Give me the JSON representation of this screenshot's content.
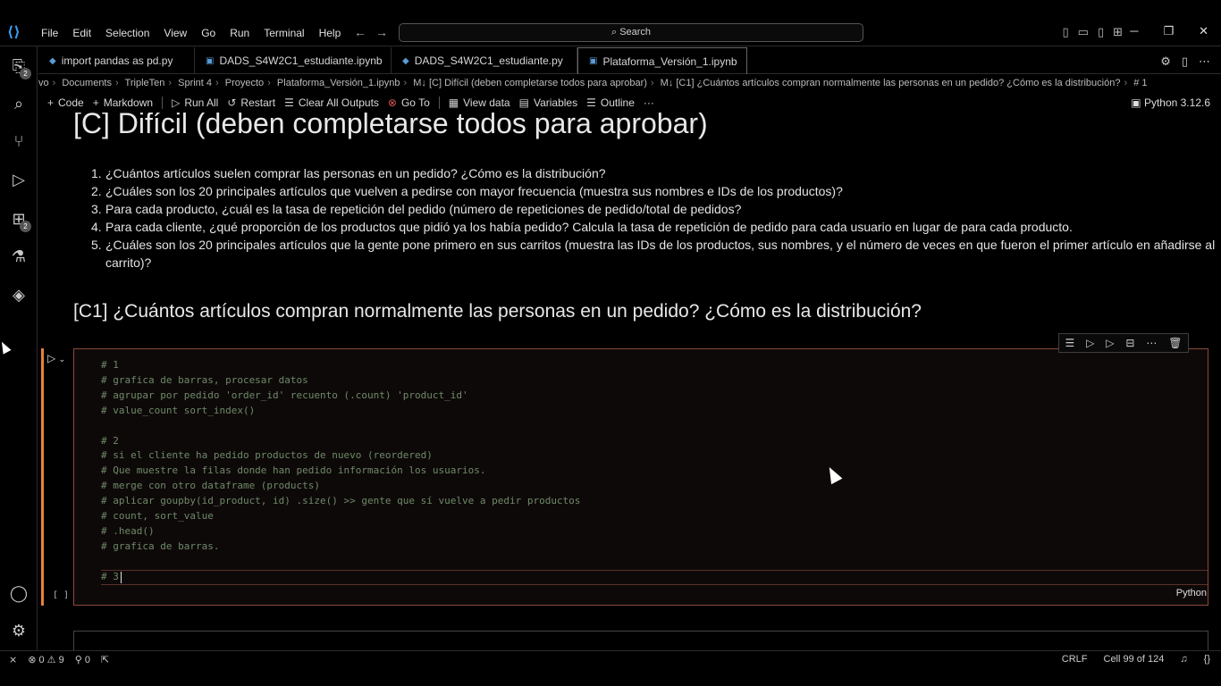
{
  "menu": [
    "File",
    "Edit",
    "Selection",
    "View",
    "Go",
    "Run",
    "Terminal",
    "Help"
  ],
  "search": {
    "label": "Search"
  },
  "tabs": [
    {
      "label": "import pandas as pd.py",
      "dirty": false
    },
    {
      "label": "DADS_S4W2C1_estudiante.ipynb",
      "dirty": true
    },
    {
      "label": "DADS_S4W2C1_estudiante.py",
      "dirty": false
    },
    {
      "label": "Plataforma_Versión_1.ipynb",
      "dirty": true
    }
  ],
  "breadcrumb": [
    "vo",
    "Documents",
    "TripleTen",
    "Sprint 4",
    "Proyecto",
    "Plataforma_Versión_1.ipynb",
    "M↓ [C] Difícil (deben completarse todos para aprobar)",
    "M↓ [C1] ¿Cuántos artículos compran normalmente las personas en un pedido? ¿Cómo es la distribución?",
    "# 1"
  ],
  "toolbar": {
    "code": "Code",
    "markdown": "Markdown",
    "run_all": "Run All",
    "restart": "Restart",
    "clear_outputs": "Clear All Outputs",
    "go_to": "Go To",
    "view_data": "View data",
    "variables": "Variables",
    "outline": "Outline",
    "more": "···",
    "kernel": "Python 3.12.6"
  },
  "activity_badges": {
    "explorer": "2",
    "extensions": "2"
  },
  "notebook": {
    "heading": "[C] Difícil (deben completarse todos para aprobar)",
    "list": [
      "¿Cuántos artículos suelen comprar las personas en un pedido? ¿Cómo es la distribución?",
      "¿Cuáles son los 20 principales artículos que vuelven a pedirse con mayor frecuencia (muestra sus nombres e IDs de los productos)?",
      "Para cada producto, ¿cuál es la tasa de repetición del pedido (número de repeticiones de pedido/total de pedidos?",
      "Para cada cliente, ¿qué proporción de los productos que pidió ya los había pedido? Calcula la tasa de repetición de pedido para cada usuario en lugar de para cada producto.",
      "¿Cuáles son los 20 principales artículos que la gente pone primero en sus carritos (muestra las IDs de los productos, sus nombres, y el número de veces en que fueron el primer artículo en añadirse al carrito)?"
    ],
    "subheading": "[C1] ¿Cuántos artículos compran normalmente las personas en un pedido? ¿Cómo es la distribución?",
    "code": "# 1\n# grafica de barras, procesar datos\n# agrupar por pedido 'order_id' recuento (.count) 'product_id'\n# value_count sort_index()\n\n# 2\n# si el cliente ha pedido productos de nuevo (reordered)\n# Que muestre la filas donde han pedido información los usuarios.\n# merge con otro dataframe (products)\n# aplicar goupby(id_product, id) .size() >> gente que sí vuelve a pedir productos\n# count, sort_value\n# .head()\n# grafica de barras.",
    "current_line": "# 3",
    "exec_count": "[ ]",
    "cell_lang": "Python"
  },
  "status": {
    "errors": "0",
    "warnings": "9",
    "ports": "0",
    "eol": "CRLF",
    "cell_pos": "Cell 99 of 124"
  }
}
